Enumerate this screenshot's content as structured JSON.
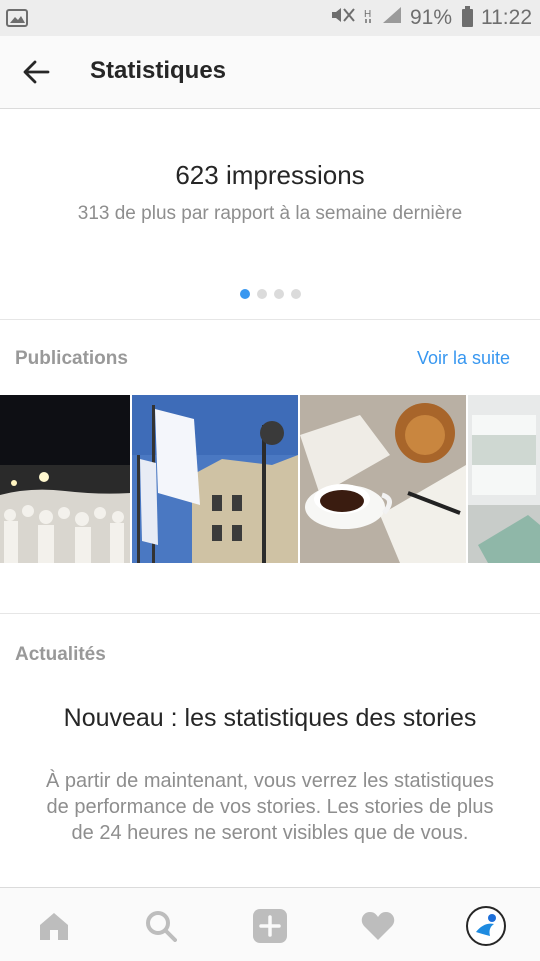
{
  "statusbar": {
    "battery": "91%",
    "time": "11:22"
  },
  "header": {
    "title": "Statistiques"
  },
  "impressions": {
    "value": "623 impressions",
    "comparison": "313 de plus par rapport à la semaine dernière",
    "pager": {
      "count": 4,
      "active": 0
    }
  },
  "publications": {
    "title": "Publications",
    "link": "Voir la suite",
    "thumbnails": [
      "crowd-night-photo",
      "banners-building-photo",
      "coffee-table-photo",
      "window-room-photo"
    ]
  },
  "news": {
    "section_title": "Actualités",
    "title": "Nouveau : les statistiques des stories",
    "body": "À partir de maintenant, vous verrez les statistiques de performance de vos stories. Les stories de plus de 24 heures ne seront visibles que de vous."
  },
  "bottom_nav": [
    "home-icon",
    "search-icon",
    "add-icon",
    "heart-icon",
    "profile-avatar"
  ],
  "colors": {
    "accent": "#3897f0",
    "muted": "#8e8e8e",
    "header_bg": "#fafafa"
  }
}
